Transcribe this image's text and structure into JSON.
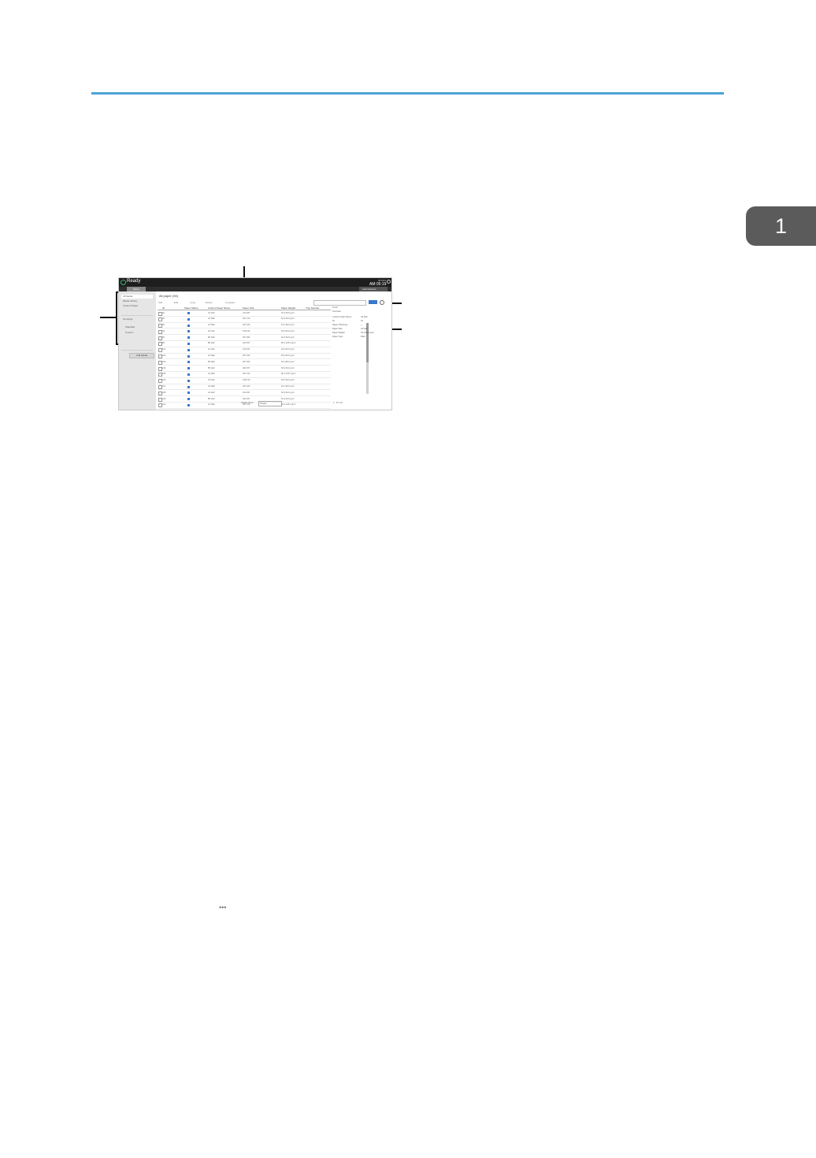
{
  "chapter": {
    "number": "1"
  },
  "screen": {
    "status": "Ready",
    "time": "AM 05:19",
    "clock_small": "00:00:0",
    "tab_active": "Menu",
    "user": "Administrator",
    "sidebar": {
      "items": [
        "All Media",
        "Media Library",
        "Custom Paper"
      ],
      "group_label": "Grouping",
      "options": [
        "Standard",
        "Custom"
      ],
      "button": "Add Media"
    },
    "main": {
      "heading": "All paper (30)",
      "toolbar": [
        "Add",
        "Edit",
        "Copy",
        "Delete",
        "Compare"
      ],
      "columns": [
        "ID",
        "Paper Status",
        "Custom Paper Name",
        "Paper Size",
        "Paper Weight",
        "Tray Number"
      ],
      "rows": [
        [
          "01",
          "A4 LEF",
          "210 297",
          "52.3-63.0 g/m²"
        ],
        [
          "02",
          "A4 SEF",
          "297 210",
          "52.3-63.0 g/m²"
        ],
        [
          "03",
          "A3 SEF",
          "297 420",
          "63.1-80.0 g/m²"
        ],
        [
          "04",
          "A5 LEF",
          "148 210",
          "52.3-63.0 g/m²"
        ],
        [
          "05",
          "B4 SEF",
          "257 364",
          "52.3-63.0 g/m²"
        ],
        [
          "06",
          "B5 LEF",
          "182 257",
          "80.1-105.0 g/m²"
        ],
        [
          "101",
          "A4 LEF",
          "210 297",
          "52.3-63.0 g/m²"
        ],
        [
          "102",
          "A3 SEF",
          "297 420",
          "52.3-63.0 g/m²"
        ],
        [
          "103",
          "B4 SEF",
          "257 364",
          "63.1-80.0 g/m²"
        ],
        [
          "104",
          "B5 LEF",
          "182 257",
          "52.3-63.0 g/m²"
        ],
        [
          "105",
          "A4 SEF",
          "297 210",
          "80.1-105.0 g/m²"
        ],
        [
          "106",
          "A5 LEF",
          "148 210",
          "52.3-63.0 g/m²"
        ],
        [
          "107",
          "A3 SEF",
          "297 420",
          "63.1-80.0 g/m²"
        ],
        [
          "108",
          "A4 LEF",
          "210 297",
          "52.3-63.0 g/m²"
        ],
        [
          "109",
          "B5 LEF",
          "182 257",
          "52.3-63.0 g/m²"
        ],
        [
          "110",
          "A4 SEF",
          "297 210",
          "80.1-105.0 g/m²"
        ],
        [
          "111",
          "B4 SEF",
          "257 364",
          "52.3-63.0 g/m²"
        ]
      ],
      "detail": {
        "title": "01-02",
        "section": "Overview",
        "fields": [
          [
            "Custom Paper Name",
            "A4 LEF"
          ],
          [
            "ID",
            "01"
          ],
          [
            "Paper Thickness",
            "—"
          ],
          [
            "Paper Size",
            "A4 LEF"
          ],
          [
            "Paper Weight",
            "52.3-63.0 g/m²"
          ],
          [
            "Paper Type",
            "Plain"
          ]
        ]
      },
      "footer": {
        "label": "Display items",
        "select_value": "Display",
        "pager": "1 - 30 / 30"
      }
    }
  }
}
